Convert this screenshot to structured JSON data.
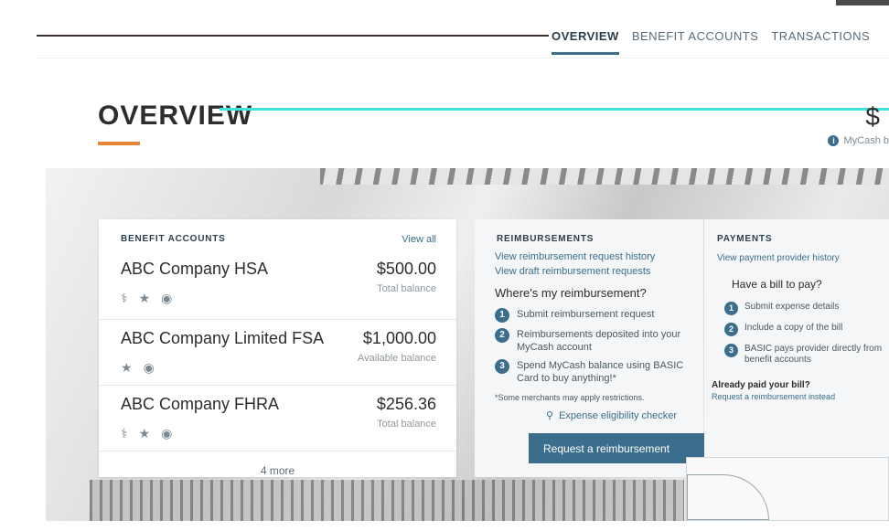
{
  "nav": {
    "tabs": [
      {
        "label": "OVERVIEW",
        "active": true
      },
      {
        "label": "BENEFIT ACCOUNTS",
        "active": false
      },
      {
        "label": "TRANSACTIONS",
        "active": false
      }
    ]
  },
  "page": {
    "title": "OVERVIEW",
    "mycash_label": "MyCash b",
    "balance_partial": "$"
  },
  "accounts": {
    "heading": "BENEFIT ACCOUNTS",
    "view_all": "View all",
    "items": [
      {
        "name": "ABC Company HSA",
        "amount": "$500.00",
        "caption": "Total balance",
        "icons": [
          "stethoscope-icon",
          "tooth-icon",
          "eye-icon"
        ]
      },
      {
        "name": "ABC Company Limited FSA",
        "amount": "$1,000.00",
        "caption": "Available balance",
        "icons": [
          "tooth-icon",
          "eye-icon"
        ]
      },
      {
        "name": "ABC Company FHRA",
        "amount": "$256.36",
        "caption": "Total balance",
        "icons": [
          "stethoscope-icon",
          "tooth-icon",
          "eye-icon"
        ]
      }
    ],
    "more": "4 more"
  },
  "reimbursements": {
    "heading": "REIMBURSEMENTS",
    "links": [
      "View reimbursement request history",
      "View draft reimbursement requests"
    ],
    "question": "Where's my reimbursement?",
    "steps": [
      "Submit reimbursement request",
      "Reimbursements deposited into your MyCash account",
      "Spend MyCash balance using BASIC Card to buy anything!*"
    ],
    "note": "*Some merchants may apply restrictions.",
    "search": "Expense eligibility checker",
    "button": "Request a reimbursement"
  },
  "payments": {
    "heading": "PAYMENTS",
    "link": "View payment provider history",
    "question": "Have a bill to pay?",
    "steps": [
      "Submit expense details",
      "Include a copy of the bill",
      "BASIC pays provider directly from benefit accounts"
    ],
    "already": "Already paid your bill?",
    "already_link": "Request a reimbursement instead"
  }
}
